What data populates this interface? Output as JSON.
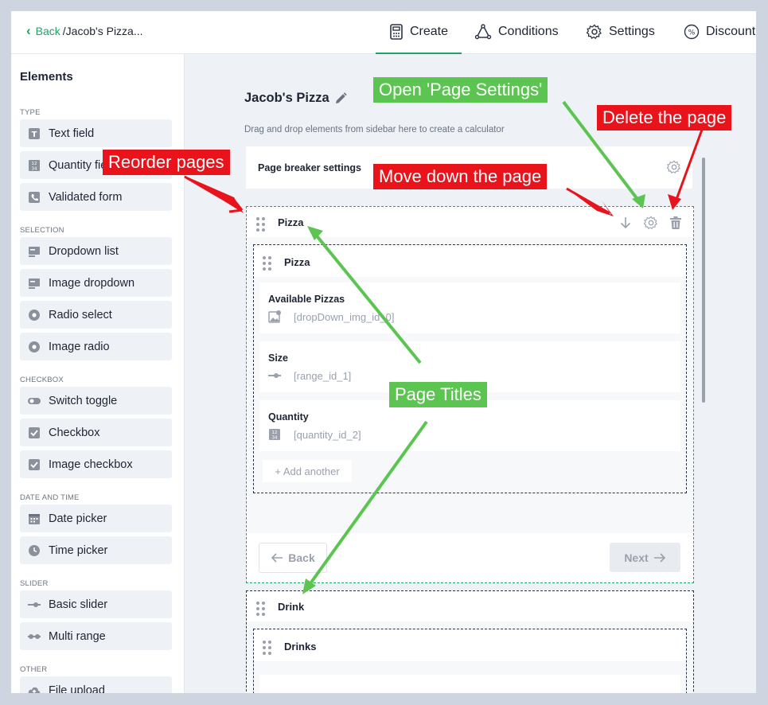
{
  "topbar": {
    "back_label": "Back",
    "breadcrumb": "/Jacob's Pizza...",
    "tabs": [
      {
        "label": "Create",
        "icon": "calculator-icon"
      },
      {
        "label": "Conditions",
        "icon": "conditions-icon"
      },
      {
        "label": "Settings",
        "icon": "gear-icon"
      },
      {
        "label": "Discount",
        "icon": "percent-icon"
      }
    ]
  },
  "sidebar": {
    "title": "Elements",
    "sections": {
      "type": "TYPE",
      "selection": "SELECTION",
      "checkbox": "CHECKBOX",
      "date": "DATE AND TIME",
      "slider": "SLIDER",
      "other": "OTHER"
    },
    "items": [
      {
        "label": "Text field",
        "icon": "text-field-icon"
      },
      {
        "label": "Quantity field",
        "icon": "quantity-icon"
      },
      {
        "label": "Validated form",
        "icon": "phone-icon"
      },
      {
        "label": "Dropdown list",
        "icon": "dropdown-icon"
      },
      {
        "label": "Image dropdown",
        "icon": "image-dropdown-icon"
      },
      {
        "label": "Radio select",
        "icon": "radio-icon"
      },
      {
        "label": "Image radio",
        "icon": "image-radio-icon"
      },
      {
        "label": "Switch toggle",
        "icon": "toggle-icon"
      },
      {
        "label": "Checkbox",
        "icon": "checkbox-icon"
      },
      {
        "label": "Image checkbox",
        "icon": "image-checkbox-icon"
      },
      {
        "label": "Date picker",
        "icon": "calendar-icon"
      },
      {
        "label": "Time picker",
        "icon": "clock-icon"
      },
      {
        "label": "Basic slider",
        "icon": "slider-icon"
      },
      {
        "label": "Multi range",
        "icon": "multi-range-icon"
      },
      {
        "label": "File upload",
        "icon": "upload-icon"
      }
    ]
  },
  "canvas": {
    "title": "Jacob's Pizza",
    "subtitle": "Drag and drop elements from sidebar here to create a calculator",
    "page_breaker_label": "Page breaker settings",
    "pages": [
      {
        "title": "Pizza",
        "group_title": "Pizza",
        "fields": [
          {
            "label": "Available Pizzas",
            "id": "[dropDown_img_id_0]",
            "icon": "image-dropdown-icon"
          },
          {
            "label": "Size",
            "id": "[range_id_1]",
            "icon": "slider-icon"
          },
          {
            "label": "Quantity",
            "id": "[quantity_id_2]",
            "icon": "quantity-icon"
          }
        ],
        "add_label": "+ Add another",
        "back_label": "Back",
        "next_label": "Next"
      },
      {
        "title": "Drink",
        "group_title": "Drinks"
      }
    ]
  },
  "annotations": {
    "open_settings": "Open 'Page Settings'",
    "delete_page": "Delete the page",
    "reorder_pages": "Reorder pages",
    "move_down": "Move down the page",
    "page_titles": "Page Titles"
  },
  "colors": {
    "accent": "#20a466",
    "annotation_red": "#e8131b",
    "annotation_green": "#5cc451",
    "canvas_bg": "#eef1f5"
  }
}
